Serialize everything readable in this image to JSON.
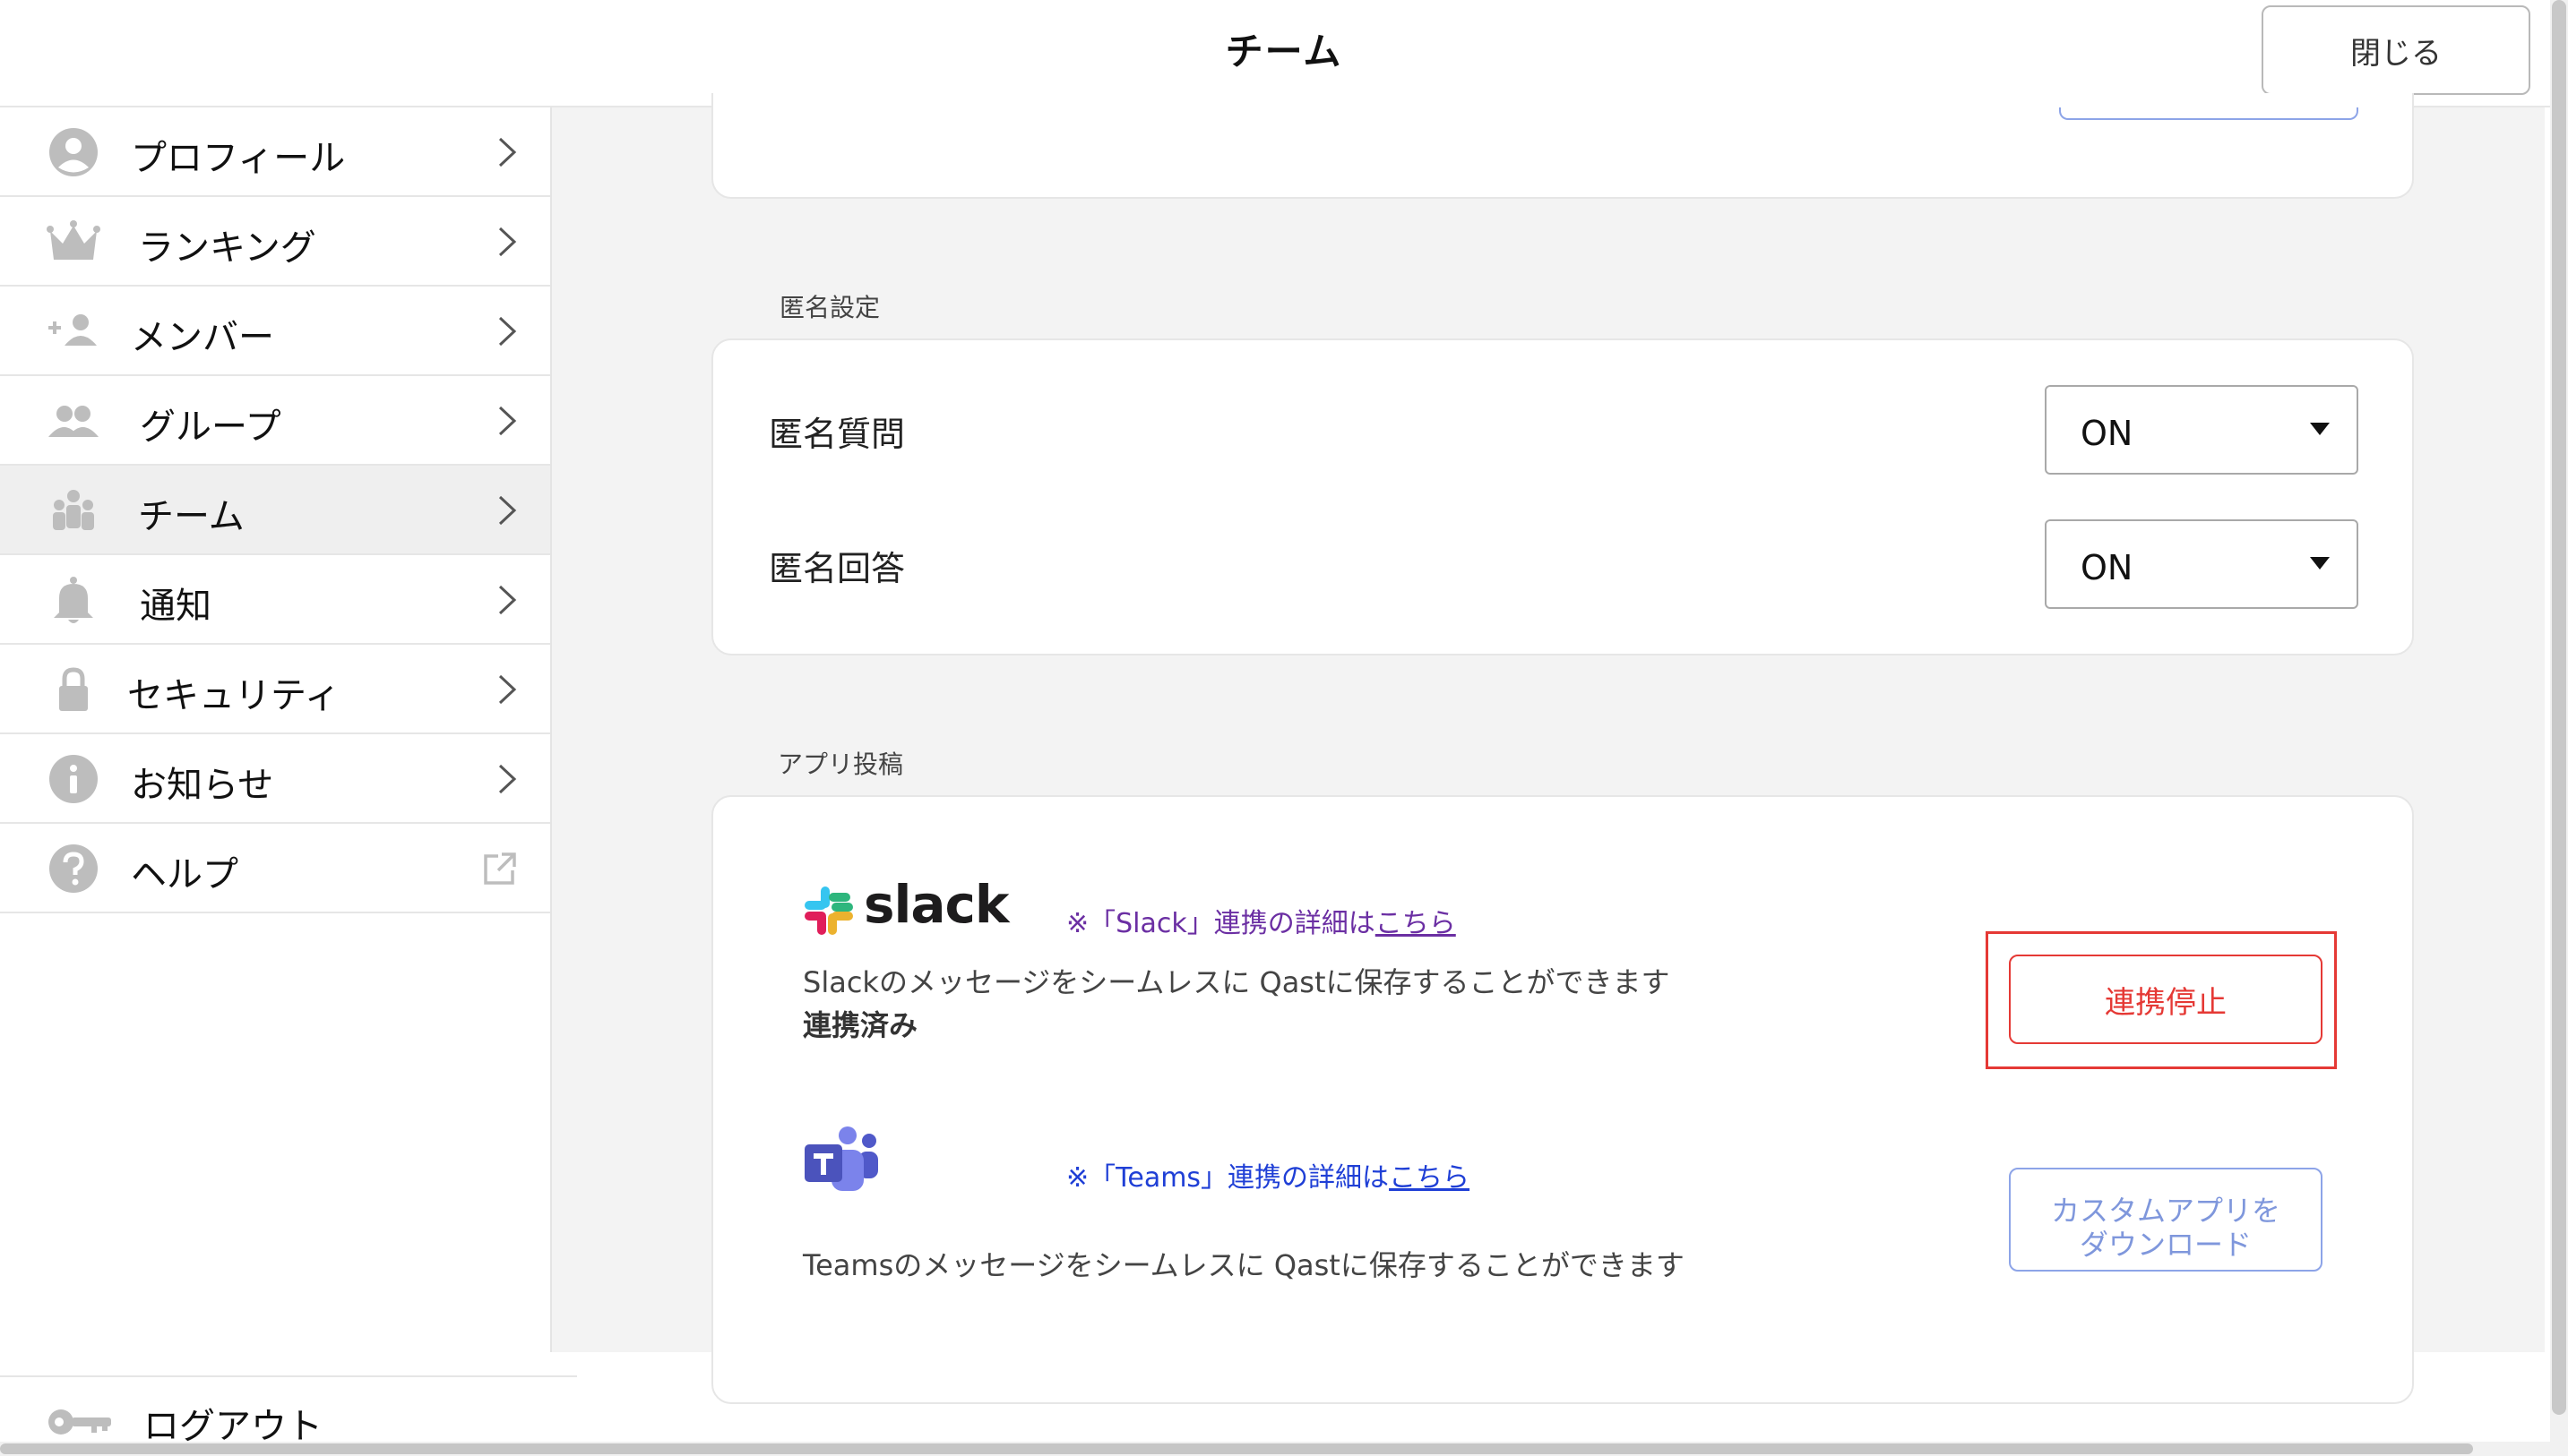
{
  "header": {
    "title": "チーム",
    "close_label": "閉じる"
  },
  "sidebar": {
    "items": [
      {
        "label": "プロフィール",
        "icon": "profile-icon"
      },
      {
        "label": "ランキング",
        "icon": "crown-icon"
      },
      {
        "label": "メンバー",
        "icon": "add-member-icon"
      },
      {
        "label": "グループ",
        "icon": "group-icon"
      },
      {
        "label": "チーム",
        "icon": "team-icon",
        "active": true
      },
      {
        "label": "通知",
        "icon": "bell-icon"
      },
      {
        "label": "セキュリティ",
        "icon": "lock-icon"
      },
      {
        "label": "お知らせ",
        "icon": "info-icon"
      },
      {
        "label": "ヘルプ",
        "icon": "help-icon",
        "trailing_icon": "external-link-icon"
      }
    ],
    "logout_label": "ログアウト"
  },
  "anonymous": {
    "section_label": "匿名設定",
    "question_label": "匿名質問",
    "question_value": "ON",
    "answer_label": "匿名回答",
    "answer_value": "ON"
  },
  "app_posting": {
    "section_label": "アプリ投稿",
    "slack": {
      "logo_text": "slack",
      "note_prefix": "※「Slack」連携の詳細は",
      "note_link": "こちら",
      "description": "Slackのメッセージをシームレスに Qastに保存することができます",
      "status": "連携済み",
      "button_label": "連携停止"
    },
    "teams": {
      "note_prefix": "※「Teams」連携の詳細は",
      "note_link": "こちら",
      "description": "Teamsのメッセージをシームレスに Qastに保存することができます",
      "button_line1": "カスタムアプリを",
      "button_line2": "ダウンロード"
    }
  },
  "colors": {
    "accent_red": "#e53935",
    "link_purple": "#6b2fa3",
    "link_blue": "#1f3fd6",
    "outline_blue": "#8da4e8"
  }
}
